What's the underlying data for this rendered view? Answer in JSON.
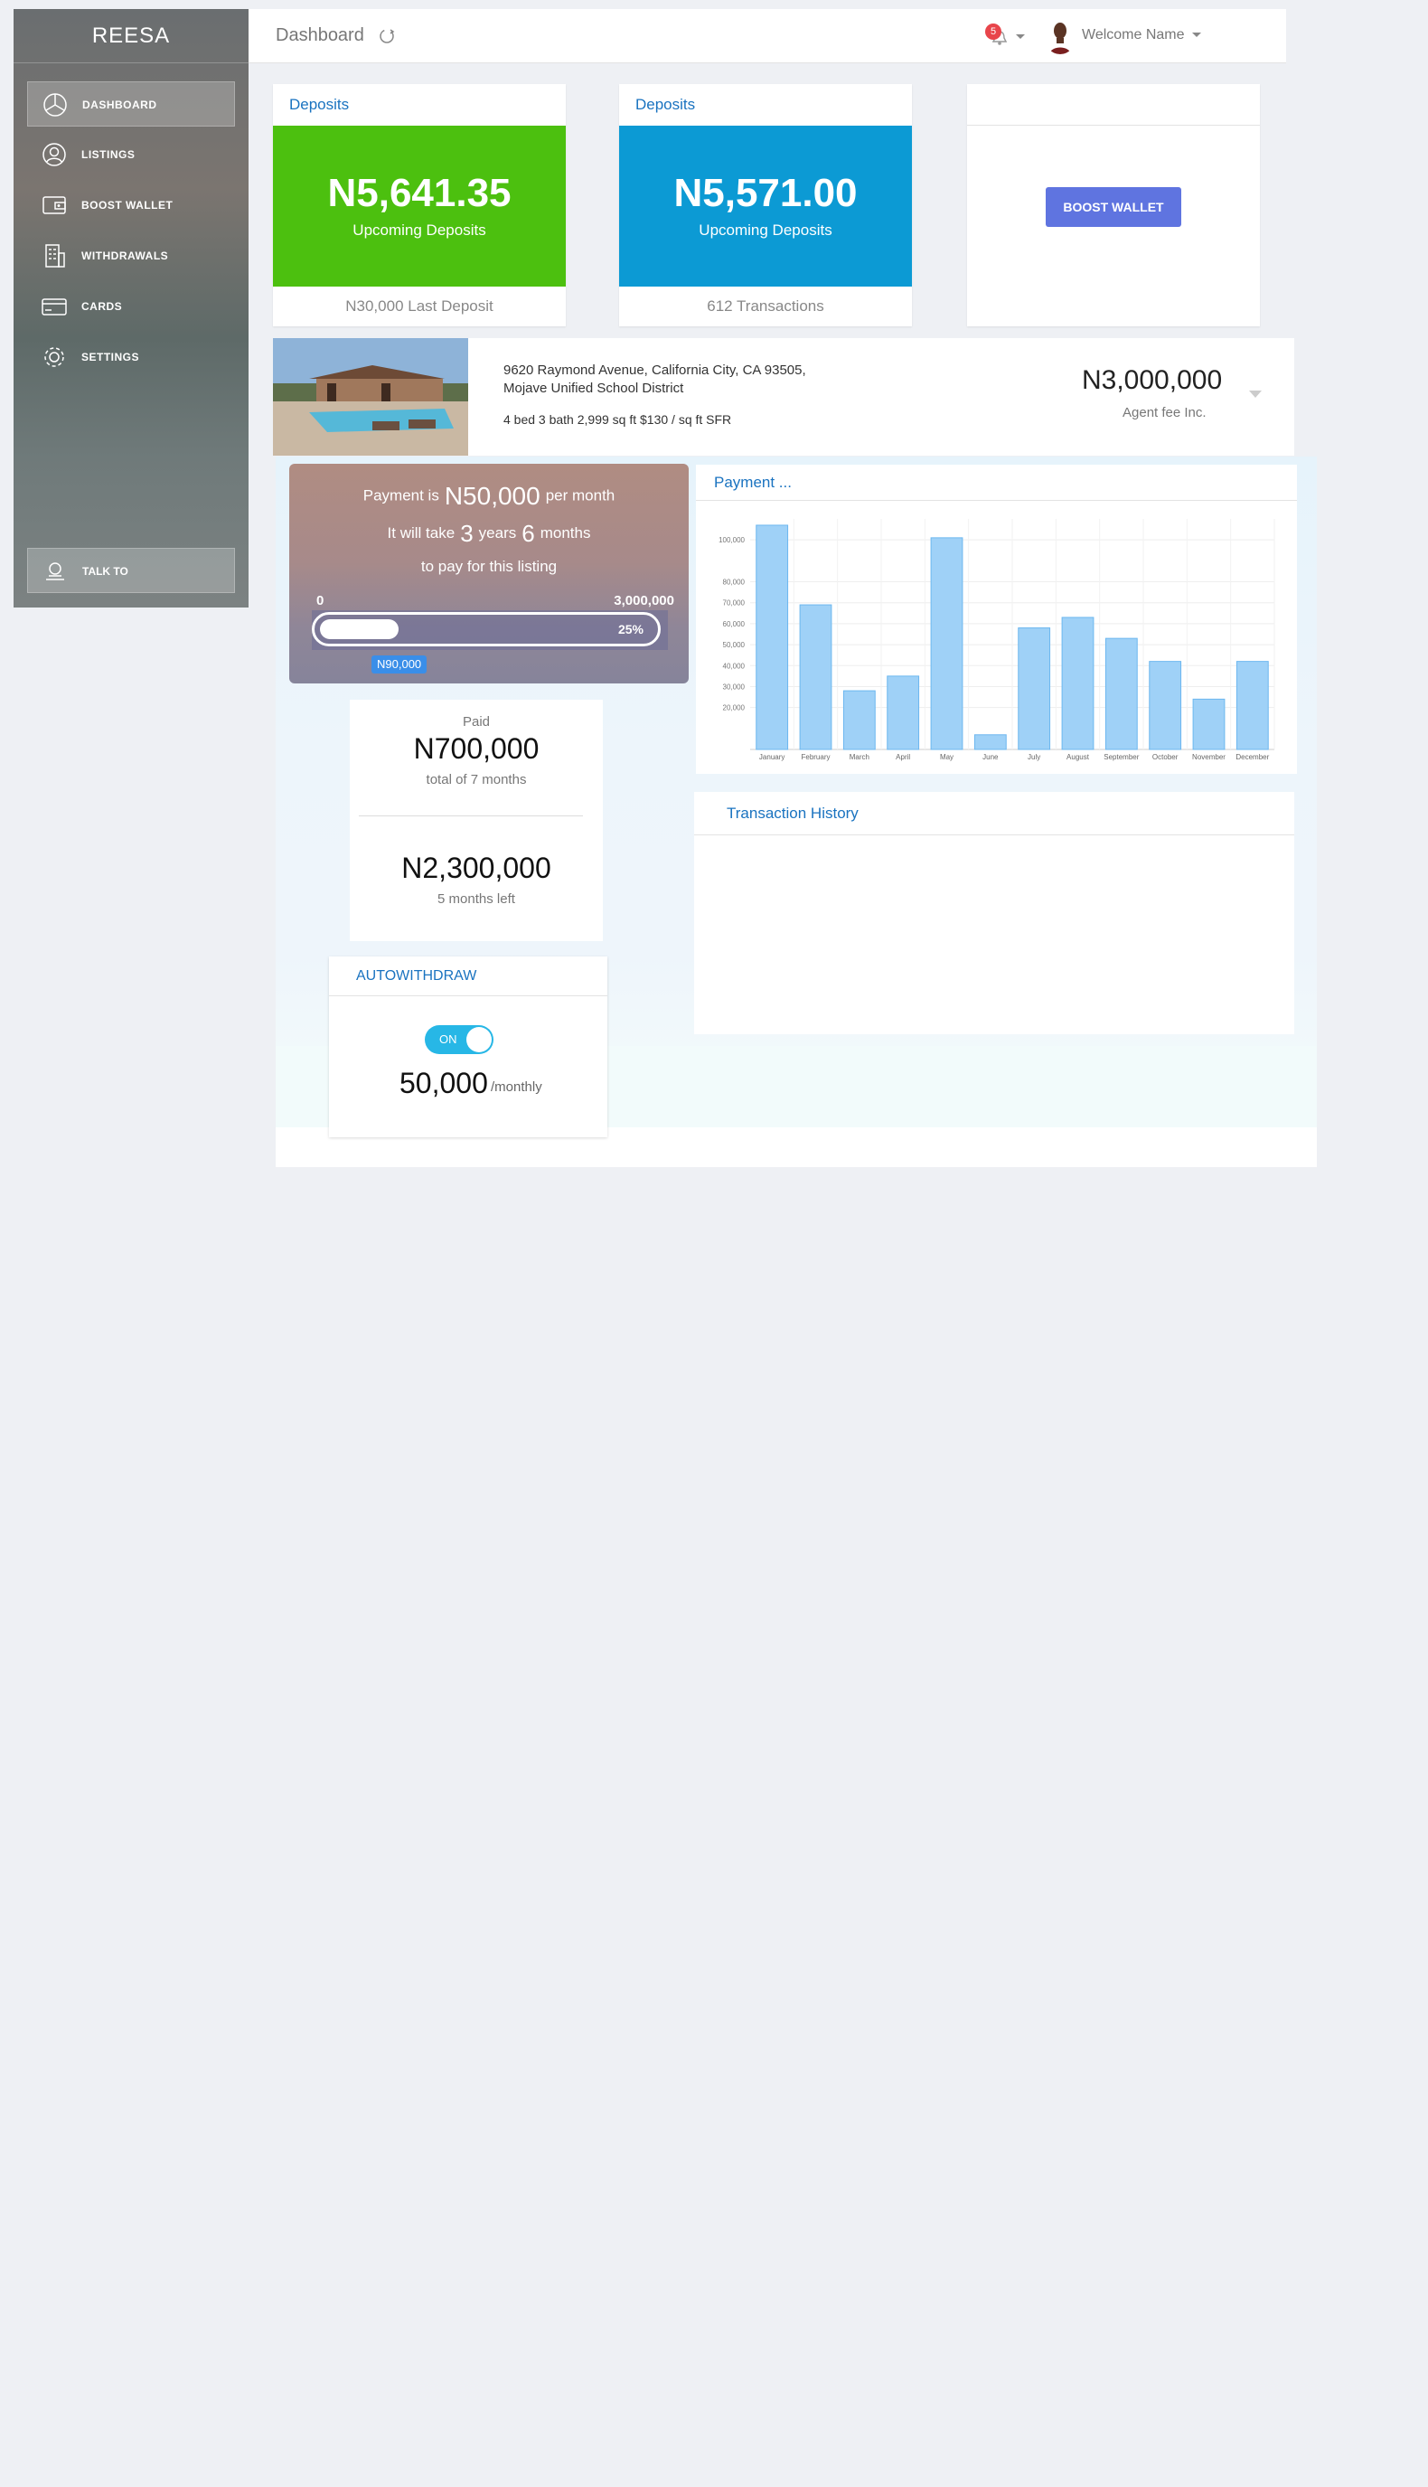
{
  "app": {
    "brand": "REESA"
  },
  "sidebar": {
    "items": [
      {
        "label": "DASHBOARD",
        "icon": "pie-chart-icon",
        "active": true
      },
      {
        "label": "LISTINGS",
        "icon": "user-icon",
        "active": false
      },
      {
        "label": "BOOST WALLET",
        "icon": "wallet-icon",
        "active": false
      },
      {
        "label": "WITHDRAWALS",
        "icon": "building-icon",
        "active": false
      },
      {
        "label": "CARDS",
        "icon": "credit-card-icon",
        "active": false
      },
      {
        "label": "SETTINGS",
        "icon": "gear-icon",
        "active": false
      }
    ],
    "talk_label": "TALK TO"
  },
  "header": {
    "title": "Dashboard",
    "notification_count": "5",
    "welcome": "Welcome Name"
  },
  "cards": {
    "deposit1": {
      "title": "Deposits",
      "amount": "N5,641.35",
      "subtitle": "Upcoming Deposits",
      "footer": "N30,000 Last Deposit",
      "color": "#4cc00f"
    },
    "deposit2": {
      "title": "Deposits",
      "amount": "N5,571.00",
      "subtitle": "Upcoming Deposits",
      "footer": "612 Transactions",
      "color": "#0c9ad4"
    },
    "boost": {
      "button_label": "BOOST WALLET",
      "color": "#5f74e0"
    }
  },
  "listing": {
    "address_line1": "9620 Raymond Avenue, California City, CA 93505,",
    "address_line2": "Mojave Unified School District",
    "specs": "4 bed 3 bath 2,999 sq ft $130 / sq ft SFR",
    "price": "N3,000,000",
    "fee_note": "Agent fee Inc."
  },
  "plan": {
    "payment_prefix": "Payment is",
    "payment_amount": "N50,000",
    "payment_suffix": "per month",
    "take_prefix": "It will take",
    "years": "3",
    "years_label": "years",
    "months": "6",
    "months_label": "months",
    "line3": "to pay for this listing",
    "range_min": "0",
    "range_max": "3,000,000",
    "progress_label": "25%",
    "progress": 0.25,
    "marker_label": "N90,000"
  },
  "paid": {
    "label": "Paid",
    "amount": "N700,000",
    "note": "total of 7 months",
    "remaining": "N2,300,000",
    "remaining_note": "5 months left"
  },
  "autowithdraw": {
    "title": "AUTOWITHDRAW",
    "toggle_label": "ON",
    "amount": "50,000",
    "period": "/monthly"
  },
  "payment_chart": {
    "title": "Payment ...",
    "chart_data": {
      "type": "bar",
      "categories": [
        "January",
        "February",
        "March",
        "April",
        "May",
        "June",
        "July",
        "August",
        "September",
        "October",
        "November",
        "December"
      ],
      "values": [
        107000,
        69000,
        28000,
        35000,
        101000,
        7000,
        58000,
        63000,
        53000,
        42000,
        24000,
        42000
      ],
      "ylim": [
        0,
        110000
      ],
      "yticks": [
        "20,000",
        "30,000",
        "40,000",
        "50,000",
        "60,000",
        "70,000",
        "80,000",
        "100,000"
      ],
      "ytick_values": [
        20000,
        30000,
        40000,
        50000,
        60000,
        70000,
        80000,
        100000
      ],
      "bar_color": "#9fd1f7",
      "bar_stroke": "#6cb7ef"
    }
  },
  "transactions": {
    "title": "Transaction History"
  }
}
